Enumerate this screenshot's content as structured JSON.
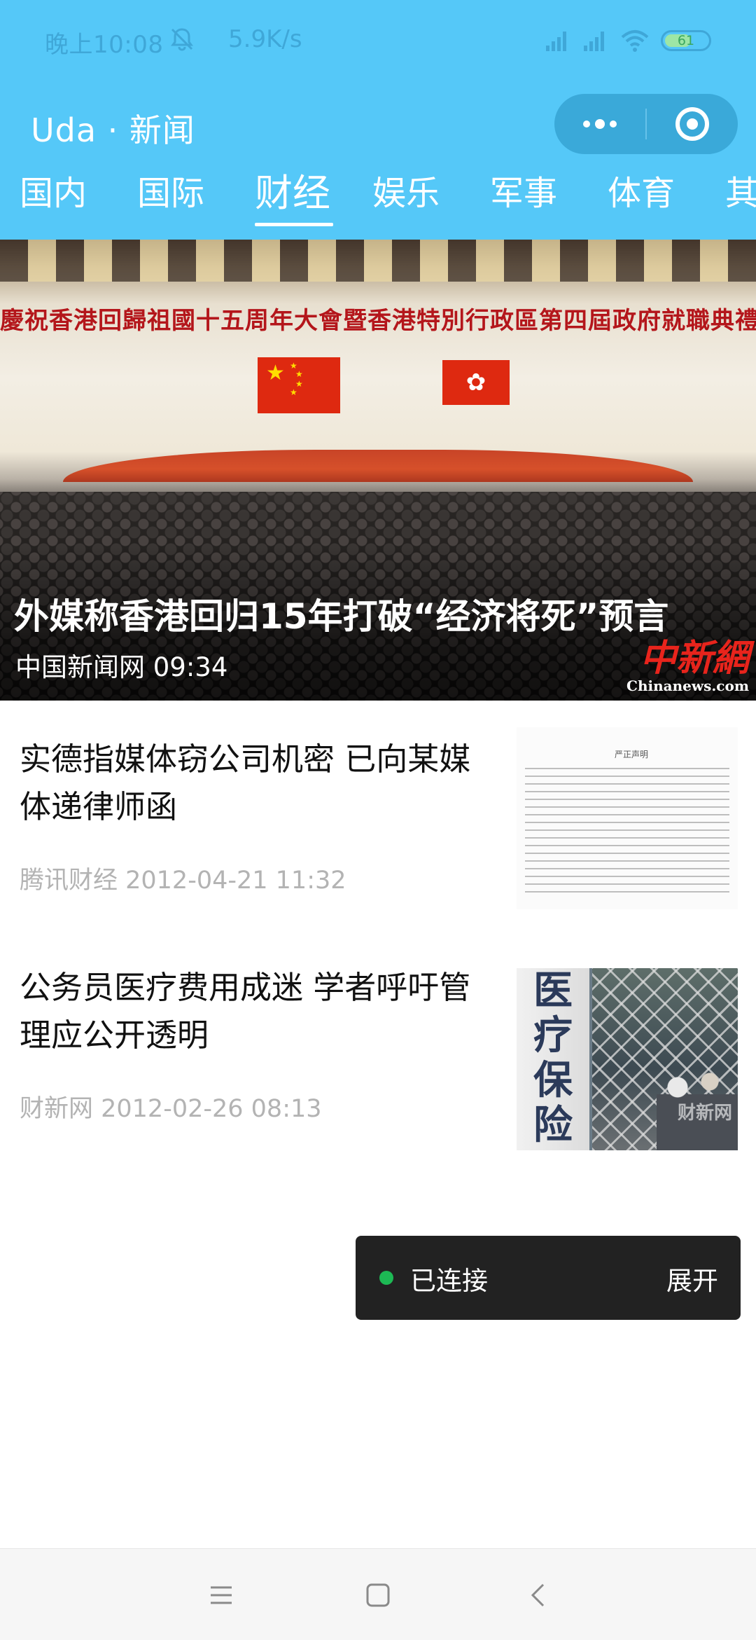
{
  "status_bar": {
    "time": "晚上10:08",
    "net_speed": "5.9K/s",
    "battery_percent": 61,
    "battery_label": "61",
    "icons": [
      "mute-bell-icon",
      "signal-icon",
      "signal-icon",
      "wifi-icon",
      "battery-icon"
    ]
  },
  "header": {
    "title": "Uda · 新闻",
    "capsule_icons": [
      "more-icon",
      "close-target-icon"
    ],
    "background": "#55c8f8"
  },
  "tabs": {
    "items": [
      {
        "label": "国内"
      },
      {
        "label": "国际"
      },
      {
        "label": "财经"
      },
      {
        "label": "娱乐"
      },
      {
        "label": "军事"
      },
      {
        "label": "体育"
      },
      {
        "label": "其"
      }
    ],
    "active": "财经"
  },
  "hero": {
    "banner": "慶祝香港回歸祖國十五周年大會暨香港特別行政區第四屆政府就職典禮",
    "title": "外媒称香港回归15年打破“经济将死”预言",
    "source": "中国新闻网",
    "time": "09:34",
    "meta": "中国新闻网 09:34",
    "watermark": "中新網",
    "watermark_en": "Chinanews.com"
  },
  "news": [
    {
      "title": "实德指媒体窃公司机密 已向某媒体递律师函",
      "meta": "腾讯财经 2012-04-21 11:32",
      "doc_heading": "严正声明"
    },
    {
      "title": "公务员医疗费用成迷 学者呼吁管理应公开透明",
      "meta": "财新网 2012-02-26 08:13",
      "sign_text": [
        "医",
        "疗",
        "保",
        "险"
      ],
      "watermark": "财新网"
    }
  ],
  "toast": {
    "status": "已连接",
    "action": "展开",
    "dot_color": "#1db954"
  },
  "nav_bar": {
    "buttons": [
      "menu-icon",
      "home-square-icon",
      "back-chevron-icon"
    ]
  }
}
